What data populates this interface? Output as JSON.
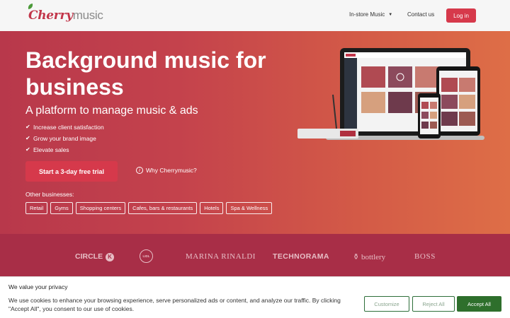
{
  "header": {
    "logo_cherry": "Cherry",
    "logo_music": "music",
    "nav_instore": "In-store Music",
    "nav_contact": "Contact us",
    "login": "Log in"
  },
  "hero": {
    "title": "Background music for business",
    "subtitle": "A platform to manage music & ads",
    "features": [
      "Increase client satisfaction",
      "Grow your brand image",
      "Elevate sales"
    ],
    "cta": "Start a 3-day free trial",
    "why_link": "Why Cherrymusic?",
    "other_label": "Other businesses:",
    "tags": [
      "Retail",
      "Gyms",
      "Shopping centers",
      "Cafes, bars & restaurants",
      "Hotels",
      "Spa & Wellness"
    ]
  },
  "brands": {
    "circle_k": "CIRCLE",
    "circle_k_k": "K",
    "lidl": "LIDL",
    "marina": "MARINA RINALDI",
    "technorama": "TECHNORAMA",
    "bottlery": "bottlery",
    "boss": "BOSS"
  },
  "cookie": {
    "title": "We value your privacy",
    "text": "We use cookies to enhance your browsing experience, serve personalized ads or content, and analyze our traffic. By clicking \"Accept All\", you consent to our use of cookies.",
    "customize": "Customize",
    "reject": "Reject All",
    "accept": "Accept All"
  },
  "colors": {
    "brand_red": "#d6394b",
    "accept_green": "#2e6f2c"
  }
}
